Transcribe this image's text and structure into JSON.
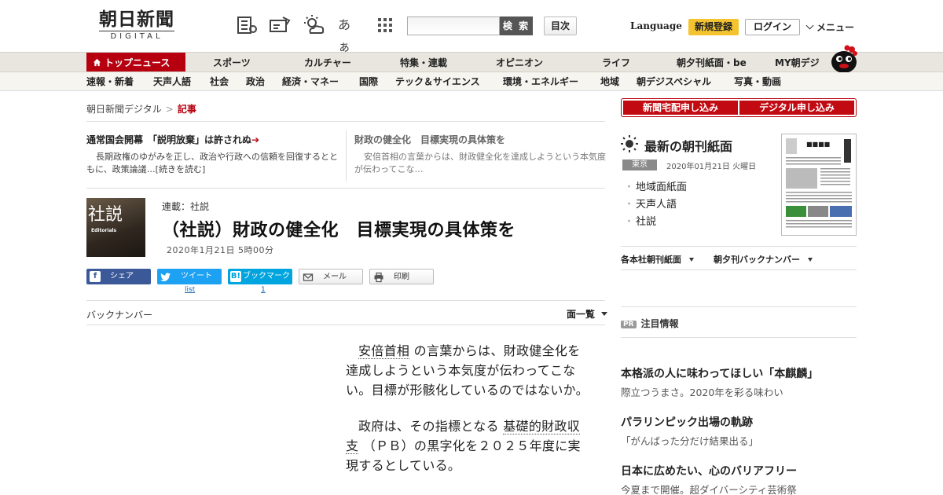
{
  "header": {
    "logo_jp": "朝日新聞",
    "logo_en": "DIGITAL",
    "search_button": "検 索",
    "search_placeholder": "",
    "toc_button": "目次",
    "language": "Language",
    "register": "新規登録",
    "login": "ログイン",
    "menu": "メニュー",
    "fontsize_icon_label": "あぁ"
  },
  "nav_primary": [
    "トップニュース",
    "スポーツ",
    "カルチャー",
    "特集・連載",
    "オピニオン",
    "ライフ",
    "朝夕刊紙面・be",
    "MY朝デジ"
  ],
  "nav_secondary": [
    "速報・新着",
    "天声人語",
    "社会",
    "政治",
    "経済・マネー",
    "国際",
    "テック＆サイエンス",
    "環境・エネルギー",
    "地域",
    "朝デジスペシャル",
    "写真・動画"
  ],
  "breadcrumb": {
    "home": "朝日新聞デジタル",
    "sep": ">",
    "current": "記事"
  },
  "featured": [
    {
      "title": "通常国会開幕　「説明放棄」は許されぬ",
      "arrow": "➔",
      "desc": "長期政権のゆがみを正し、政治や行政への信頼を回復するとともに、政策論議…[続きを読む]"
    },
    {
      "title": "財政の健全化　目標実現の具体策を",
      "desc": "安倍首相の言葉からは、財政健全化を達成しようという本気度が伝わってこな…"
    }
  ],
  "article": {
    "thumb_kanji": "社説",
    "thumb_en": "Editorials",
    "series": "連載：社説",
    "title": "（社説）財政の健全化　目標実現の具体策を",
    "date": "2020年1月21日 5時00分",
    "paragraphs": [
      {
        "pre": "",
        "link": "安倍首相",
        "post": " の言葉からは、財政健全化を達成しようという本気度が伝わってこない。目標が形骸化しているのではないか。"
      },
      {
        "pre": "政府は、その指標となる ",
        "link": "基礎的財政収支",
        "post": " （ＰＢ）の黒字化を２０２５年度に実現するとしている。"
      },
      {
        "pre": "",
        "link": "",
        "post": ""
      }
    ]
  },
  "share": {
    "facebook": "シェア",
    "twitter": "ツイート",
    "twitter_count": "list",
    "hatena": "ブックマーク",
    "hatena_count": "1",
    "mail": "メール",
    "print": "印刷"
  },
  "backnumber": "バックナンバー",
  "men_list": "面一覧",
  "sidebar": {
    "subscribe_paper": "新聞宅配申し込み",
    "subscribe_digital": "デジタル申し込み",
    "newspaper_title": "最新の朝刊紙面",
    "region": "東京",
    "paper_date": "2020年01月21日 火曜日",
    "paper_links": [
      "地域面紙面",
      "天声人語",
      "社説"
    ],
    "select_regional": "各本社朝刊紙面",
    "select_backnumber": "朝夕刊バックナンバー",
    "pr_badge": "PR",
    "pr_heading": "注目情報",
    "pr_items": [
      {
        "title": "本格派の人に味わってほしい「本麒麟」",
        "desc": "際立つうまさ。2020年を彩る味わい"
      },
      {
        "title": "パラリンピック出場の軌跡",
        "desc": "「がんばった分だけ結果出る」"
      },
      {
        "title": "日本に広めたい、心のバリアフリー",
        "desc": "今夏まで開催。超ダイバーシティ芸術祭"
      }
    ]
  },
  "colors": {
    "brand_red": "#b7000f",
    "register_yellow": "#f4c430",
    "facebook": "#3b5998",
    "twitter": "#1da1f2",
    "hatena": "#00a4de"
  }
}
